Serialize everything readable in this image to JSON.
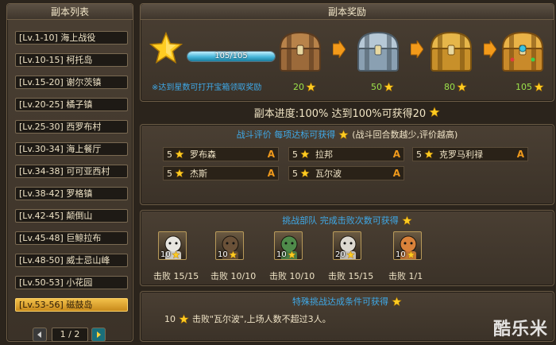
{
  "left_panel": {
    "title": "副本列表",
    "items": [
      {
        "label": "[Lv.1-10] 海上战役"
      },
      {
        "label": "[Lv.10-15] 柯托岛"
      },
      {
        "label": "[Lv.15-20] 谢尔茨镇"
      },
      {
        "label": "[Lv.20-25] 橘子镇"
      },
      {
        "label": "[Lv.25-30] 西罗布村"
      },
      {
        "label": "[Lv.30-34] 海上餐厅"
      },
      {
        "label": "[Lv.34-38] 可可亚西村"
      },
      {
        "label": "[Lv.38-42] 罗格镇"
      },
      {
        "label": "[Lv.42-45] 颠倒山"
      },
      {
        "label": "[Lv.45-48] 巨鲸拉布"
      },
      {
        "label": "[Lv.48-50] 威士忌山峰"
      },
      {
        "label": "[Lv.50-53] 小花园"
      },
      {
        "label": "[Lv.53-56] 磁鼓岛",
        "active": true
      }
    ],
    "pager": {
      "text": "1 / 2"
    }
  },
  "reward_panel": {
    "title": "副本奖励",
    "progress_text": "105/105",
    "progress_fraction": 1.0,
    "hint": "※达到星数可打开宝箱领取奖励",
    "chests": [
      {
        "requirement": "20",
        "type": "wood"
      },
      {
        "requirement": "50",
        "type": "silver"
      },
      {
        "requirement": "80",
        "type": "gold"
      },
      {
        "requirement": "105",
        "type": "jewel"
      }
    ]
  },
  "progress_line": {
    "text": "副本进度:100%  达到100%可获得20"
  },
  "rating_panel": {
    "title_main": "战斗评价 每项达标可获得",
    "title_note": "(战斗回合数越少,评价越高)",
    "entries": [
      {
        "count": "5",
        "name": "罗布森",
        "grade": "A"
      },
      {
        "count": "5",
        "name": "拉邦",
        "grade": "A"
      },
      {
        "count": "5",
        "name": "克罗马利禄",
        "grade": "A"
      },
      {
        "count": "5",
        "name": "杰斯",
        "grade": "A"
      },
      {
        "count": "5",
        "name": "瓦尔波",
        "grade": "A"
      }
    ]
  },
  "team_panel": {
    "title": "挑战部队 完成击败次数可获得",
    "members": [
      {
        "reward": "10",
        "defeat": "击败 15/15",
        "color": "#e8e6e0"
      },
      {
        "reward": "10",
        "defeat": "击败 10/10",
        "color": "#6a5138"
      },
      {
        "reward": "10",
        "defeat": "击败 10/10",
        "color": "#4f8b4a"
      },
      {
        "reward": "20",
        "defeat": "击败 15/15",
        "color": "#dcd8d0"
      },
      {
        "reward": "10",
        "defeat": "击败 1/1",
        "color": "#d9823a"
      }
    ]
  },
  "special_panel": {
    "title": "特殊挑战达成条件可获得",
    "line_count": "10",
    "line_text": "击败\"瓦尔波\",上场人数不超过3人。"
  },
  "watermark": "酷乐米",
  "colors": {
    "accent_gold": "#f2c04a",
    "hint_blue": "#3fa9e8",
    "requirement_green": "#9ce24a",
    "grade_orange": "#f09a1c"
  }
}
